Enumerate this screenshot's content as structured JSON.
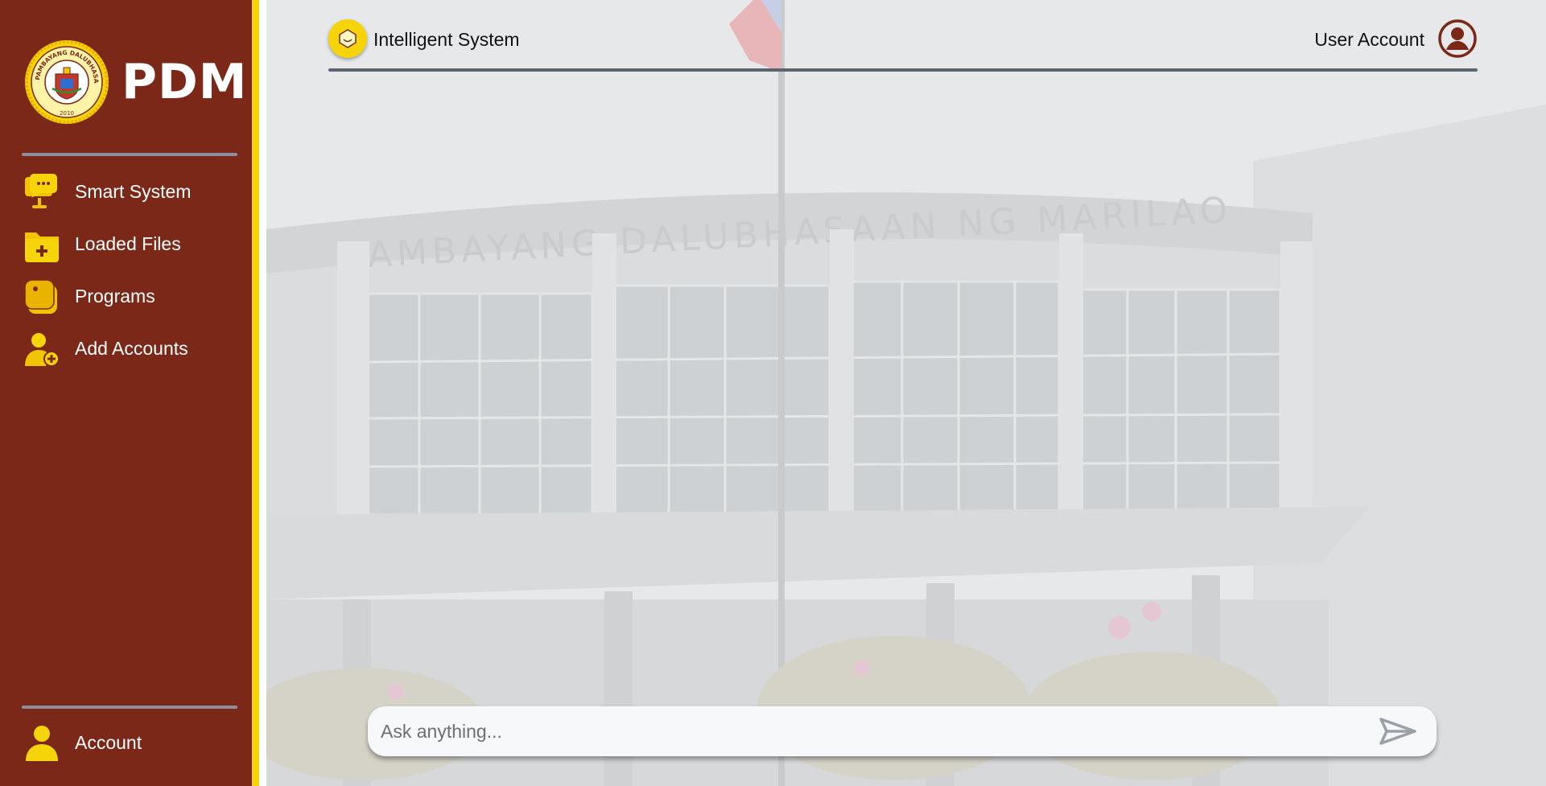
{
  "brand": {
    "name": "PDM",
    "seal_text": "PAMBAYANG DALUBHASAAN NG MARILAO",
    "seal_year": "2010"
  },
  "nav": {
    "items": [
      {
        "label": "Smart System",
        "icon": "chat-monitor-icon"
      },
      {
        "label": "Loaded Files",
        "icon": "folder-plus-icon"
      },
      {
        "label": "Programs",
        "icon": "programs-icon"
      },
      {
        "label": "Add Accounts",
        "icon": "add-user-icon"
      }
    ],
    "account_label": "Account"
  },
  "header": {
    "title": "Intelligent System",
    "user_label": "User Account"
  },
  "background": {
    "building_sign": "PAMBAYANG DALUBHASAAN NG MARILAO"
  },
  "chat": {
    "placeholder": "Ask anything..."
  },
  "colors": {
    "sidebar_bg": "#7c2819",
    "accent_yellow": "#f6d40a",
    "icon_yellow": "#f2c400",
    "divider": "#8d8f9f",
    "header_line": "#5d6573"
  }
}
